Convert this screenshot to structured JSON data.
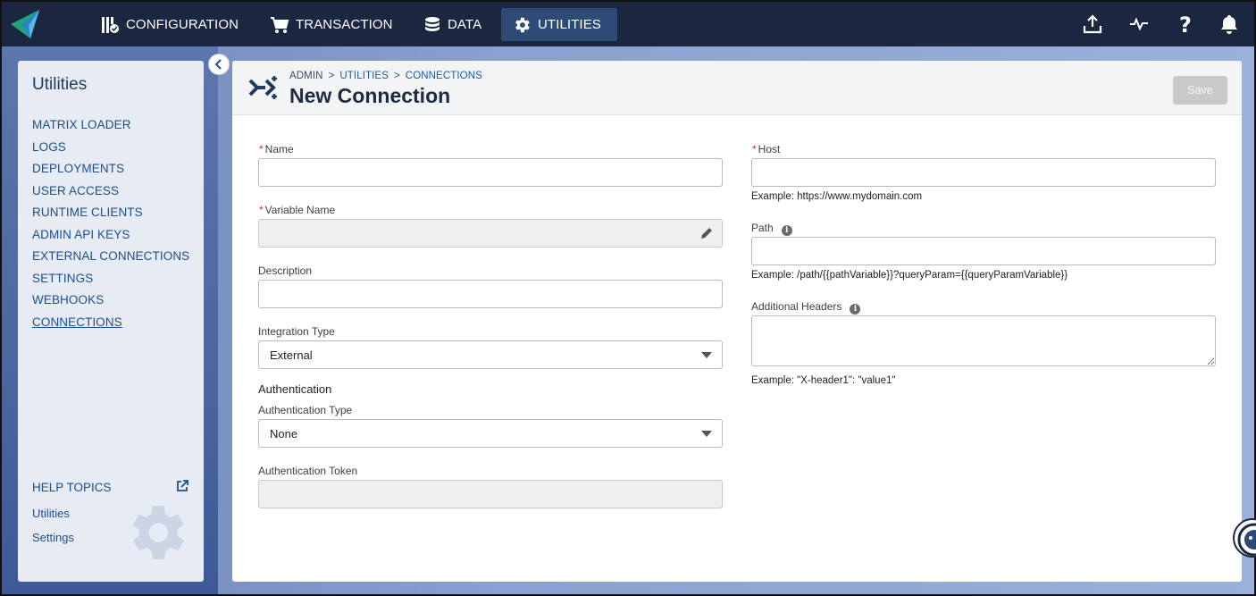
{
  "nav": {
    "items": [
      {
        "label": "CONFIGURATION",
        "icon": "configuration-icon"
      },
      {
        "label": "TRANSACTION",
        "icon": "cart-icon"
      },
      {
        "label": "DATA",
        "icon": "database-icon"
      },
      {
        "label": "UTILITIES",
        "icon": "gear-icon"
      }
    ],
    "active": "UTILITIES",
    "right_icons": [
      "upload-icon",
      "activity-icon",
      "help-icon",
      "bell-icon"
    ]
  },
  "sidebar": {
    "title": "Utilities",
    "items": [
      {
        "label": "MATRIX LOADER"
      },
      {
        "label": "LOGS"
      },
      {
        "label": "DEPLOYMENTS"
      },
      {
        "label": "USER ACCESS"
      },
      {
        "label": "RUNTIME CLIENTS"
      },
      {
        "label": "ADMIN API KEYS"
      },
      {
        "label": "EXTERNAL CONNECTIONS"
      },
      {
        "label": "SETTINGS"
      },
      {
        "label": "WEBHOOKS"
      },
      {
        "label": "CONNECTIONS"
      }
    ],
    "current": "CONNECTIONS",
    "help_topics": "HELP TOPICS",
    "help_links": [
      "Utilities",
      "Settings"
    ]
  },
  "header": {
    "breadcrumb": [
      "ADMIN",
      "UTILITIES",
      "CONNECTIONS"
    ],
    "title": "New Connection",
    "save_label": "Save"
  },
  "form": {
    "name": {
      "label": "Name",
      "required": true,
      "value": ""
    },
    "variable_name": {
      "label": "Variable Name",
      "required": true,
      "value": ""
    },
    "description": {
      "label": "Description",
      "value": ""
    },
    "integration_type": {
      "label": "Integration Type",
      "value": "External"
    },
    "authentication_section": "Authentication",
    "authentication_type": {
      "label": "Authentication Type",
      "value": "None"
    },
    "authentication_token": {
      "label": "Authentication Token",
      "value": ""
    },
    "host": {
      "label": "Host",
      "required": true,
      "value": "",
      "hint": "Example: https://www.mydomain.com"
    },
    "path": {
      "label": "Path",
      "value": "",
      "hint": "Example: /path/{{pathVariable}}?queryParam={{queryParamVariable}}"
    },
    "additional_headers": {
      "label": "Additional Headers",
      "value": "",
      "hint": "Example: \"X-header1\": \"value1\""
    }
  },
  "colors": {
    "topbar": "#1b2740",
    "active_nav": "#2e4a76",
    "link": "#1c4f8c",
    "required": "#c23934"
  }
}
